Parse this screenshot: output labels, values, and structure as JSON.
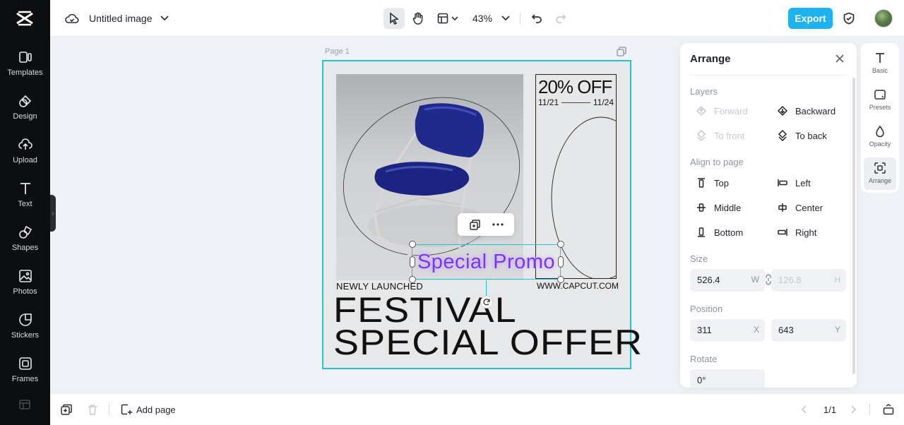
{
  "header": {
    "doc_title": "Untitled image",
    "zoom": "43%",
    "export_label": "Export"
  },
  "rail": {
    "items": [
      {
        "label": "Templates",
        "icon": "templates-icon"
      },
      {
        "label": "Design",
        "icon": "design-icon"
      },
      {
        "label": "Upload",
        "icon": "upload-icon"
      },
      {
        "label": "Text",
        "icon": "text-icon"
      },
      {
        "label": "Shapes",
        "icon": "shapes-icon"
      },
      {
        "label": "Photos",
        "icon": "photos-icon"
      },
      {
        "label": "Stickers",
        "icon": "stickers-icon"
      },
      {
        "label": "Frames",
        "icon": "frames-icon"
      }
    ]
  },
  "canvas": {
    "page_label": "Page 1",
    "offer": "20% OFF",
    "date_start": "11/21",
    "date_end": "11/24",
    "newly": "NEWLY LAUNCHED",
    "website": "WWW.CAPCUT.COM",
    "headline_1": "FESTIVAL",
    "headline_2": "SPECIAL OFFER",
    "selected_text": "Special Promo"
  },
  "panel": {
    "title": "Arrange",
    "layers_label": "Layers",
    "forward": "Forward",
    "backward": "Backward",
    "to_front": "To front",
    "to_back": "To back",
    "align_label": "Align to page",
    "top": "Top",
    "left": "Left",
    "middle": "Middle",
    "center": "Center",
    "bottom": "Bottom",
    "right": "Right",
    "size_label": "Size",
    "width": "526.4",
    "width_unit": "W",
    "height": "126.8",
    "height_unit": "H",
    "position_label": "Position",
    "pos_x": "311",
    "pos_x_unit": "X",
    "pos_y": "643",
    "pos_y_unit": "Y",
    "rotate_label": "Rotate",
    "rotate": "0°"
  },
  "right_tabs": [
    {
      "label": "Basic"
    },
    {
      "label": "Presets"
    },
    {
      "label": "Opacity"
    },
    {
      "label": "Arrange"
    }
  ],
  "footer": {
    "add_page": "Add page",
    "pager": "1/1"
  },
  "colors": {
    "accent": "#1eb3ee",
    "selection": "#27c1cf",
    "promo_text": "#7b34f2",
    "chair": "#1f2a8c"
  }
}
